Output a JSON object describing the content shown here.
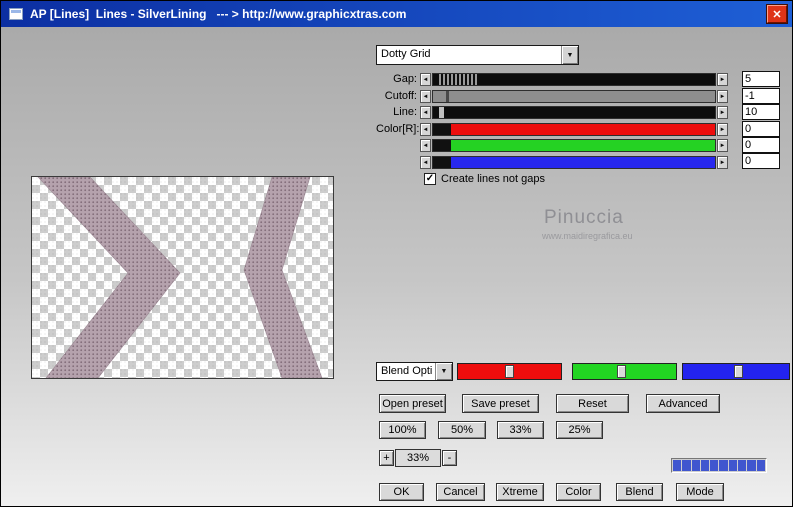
{
  "window": {
    "title": "AP [Lines]  Lines - SilverLining   --- > http://www.graphicxtras.com"
  },
  "icons": {
    "close": "✕",
    "dropdown": "▼",
    "arrow_left": "◄",
    "arrow_right": "►",
    "check": "✓"
  },
  "preset": {
    "value": "Dotty Grid"
  },
  "params": [
    {
      "label": "Gap:",
      "value": "5"
    },
    {
      "label": "Cutoff:",
      "value": "-1"
    },
    {
      "label": "Line:",
      "value": "10"
    },
    {
      "label": "Color[R]:",
      "value": "0"
    },
    {
      "label": "",
      "value": "0"
    },
    {
      "label": "",
      "value": "0"
    }
  ],
  "options": {
    "create_lines_label": "Create lines not gaps",
    "create_lines_checked": true
  },
  "watermark": {
    "name": "Pinuccia",
    "site": "www.maidiregrafica.eu"
  },
  "blend": {
    "value": "Blend Opti"
  },
  "buttons": {
    "open_preset": "Open preset",
    "save_preset": "Save preset",
    "reset": "Reset",
    "advanced": "Advanced",
    "p100": "100%",
    "p50": "50%",
    "p33": "33%",
    "p25": "25%",
    "ok": "OK",
    "cancel": "Cancel",
    "xtreme": "Xtreme",
    "color": "Color",
    "blend": "Blend",
    "mode": "Mode"
  },
  "zoom": {
    "plus": "+",
    "value": "33%",
    "minus": "-"
  },
  "colors": {
    "titlebar": "#1550c8",
    "close_button": "#de3418",
    "slider_red": "#ee0d0d",
    "slider_green": "#22d522",
    "slider_blue": "#2323ef",
    "band_mauve": "#b5a2ad",
    "progress_blue": "#4056cf"
  }
}
